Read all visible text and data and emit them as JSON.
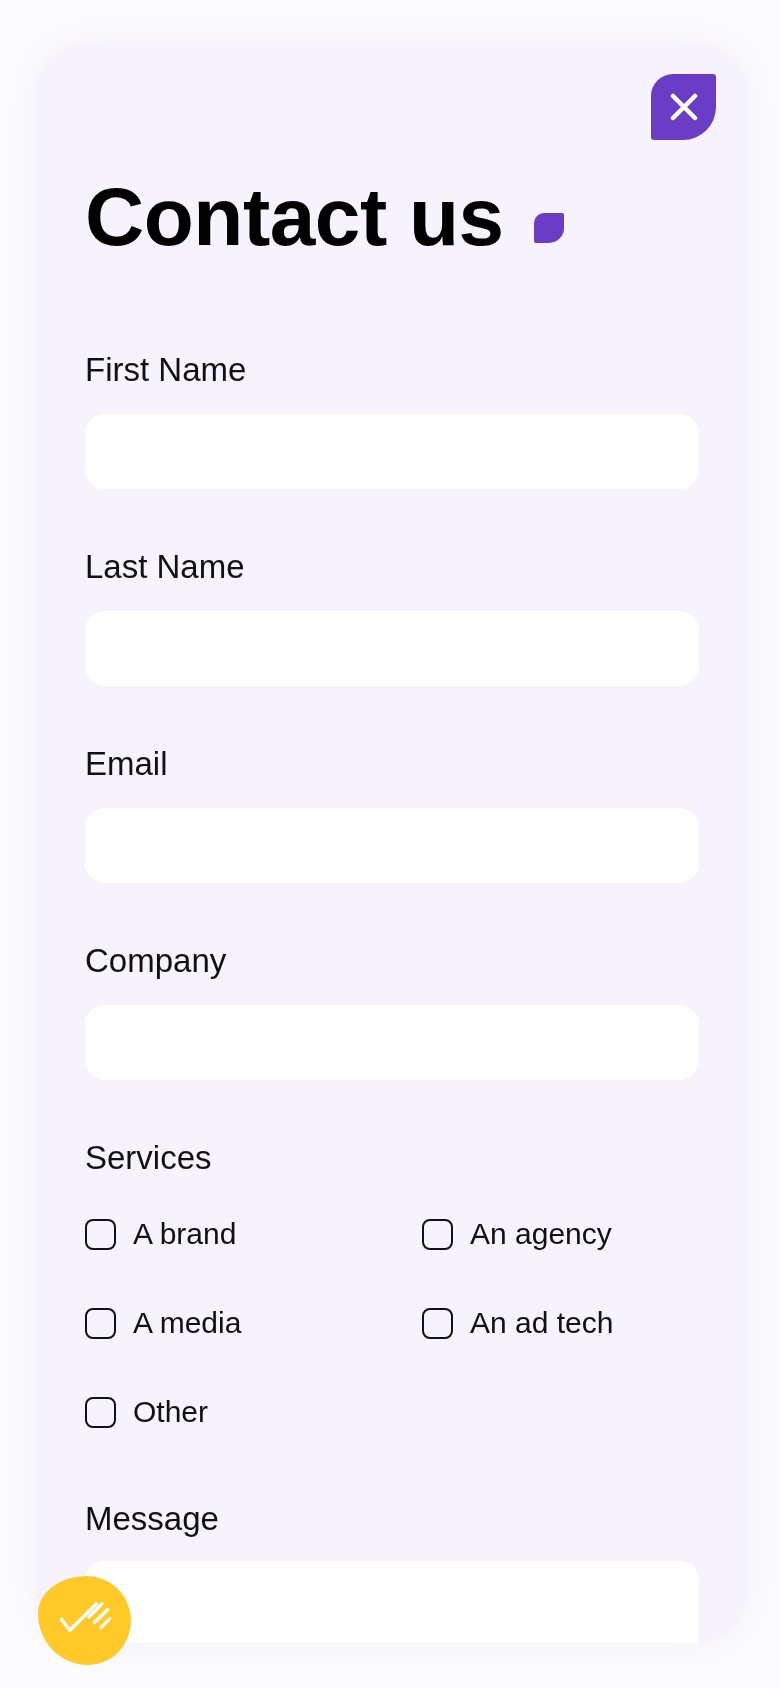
{
  "title": "Contact us",
  "fields": [
    {
      "kind": "text",
      "label": "First Name"
    },
    {
      "kind": "text",
      "label": "Last Name"
    },
    {
      "kind": "text",
      "label": "Email"
    },
    {
      "kind": "text",
      "label": "Company"
    },
    {
      "kind": "checkboxes",
      "label": "Services",
      "options": [
        {
          "label": "A brand",
          "checked": false
        },
        {
          "label": "An agency",
          "checked": false
        },
        {
          "label": "A media",
          "checked": false
        },
        {
          "label": "An ad tech",
          "checked": false
        },
        {
          "label": "Other",
          "checked": false
        }
      ]
    },
    {
      "kind": "textarea",
      "label": "Message"
    }
  ]
}
